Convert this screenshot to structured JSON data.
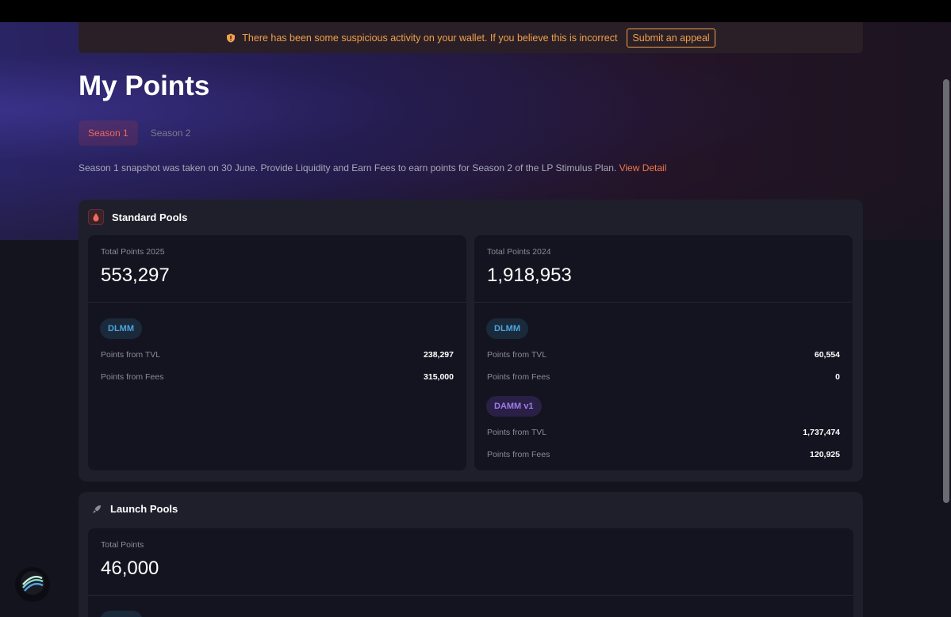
{
  "alert": {
    "message": "There has been some suspicious activity on your wallet. If you believe this is incorrect",
    "action_label": "Submit an appeal",
    "icon": "warning-shield-icon",
    "color": "#f0a04b"
  },
  "page": {
    "title": "My Points"
  },
  "tabs": [
    {
      "label": "Season 1",
      "active": true
    },
    {
      "label": "Season 2",
      "active": false
    }
  ],
  "notice": {
    "text": "Season 1 snapshot was taken on 30 June. Provide Liquidity and Earn Fees to earn points for Season 2 of the LP Stimulus Plan.",
    "link_label": "View Detail"
  },
  "standard_pools": {
    "title": "Standard Pools",
    "icon": "droplet-icon",
    "cards": [
      {
        "label": "Total Points 2025",
        "total": "553,297",
        "groups": [
          {
            "badge": "DLMM",
            "rows": [
              {
                "label": "Points from TVL",
                "value": "238,297"
              },
              {
                "label": "Points from Fees",
                "value": "315,000"
              }
            ]
          }
        ]
      },
      {
        "label": "Total Points 2024",
        "total": "1,918,953",
        "groups": [
          {
            "badge": "DLMM",
            "rows": [
              {
                "label": "Points from TVL",
                "value": "60,554"
              },
              {
                "label": "Points from Fees",
                "value": "0"
              }
            ]
          },
          {
            "badge": "DAMM v1",
            "rows": [
              {
                "label": "Points from TVL",
                "value": "1,737,474"
              },
              {
                "label": "Points from Fees",
                "value": "120,925"
              }
            ]
          }
        ]
      }
    ]
  },
  "launch_pools": {
    "title": "Launch Pools",
    "icon": "rocket-icon",
    "card": {
      "label": "Total Points",
      "total": "46,000"
    }
  },
  "fab": {
    "icon": "app-logo-icon"
  },
  "colors": {
    "accent": "#f07a4a",
    "tab_active": "#f06a5a",
    "dlmm": "#4ea3e0",
    "damm": "#9b7cf0"
  }
}
